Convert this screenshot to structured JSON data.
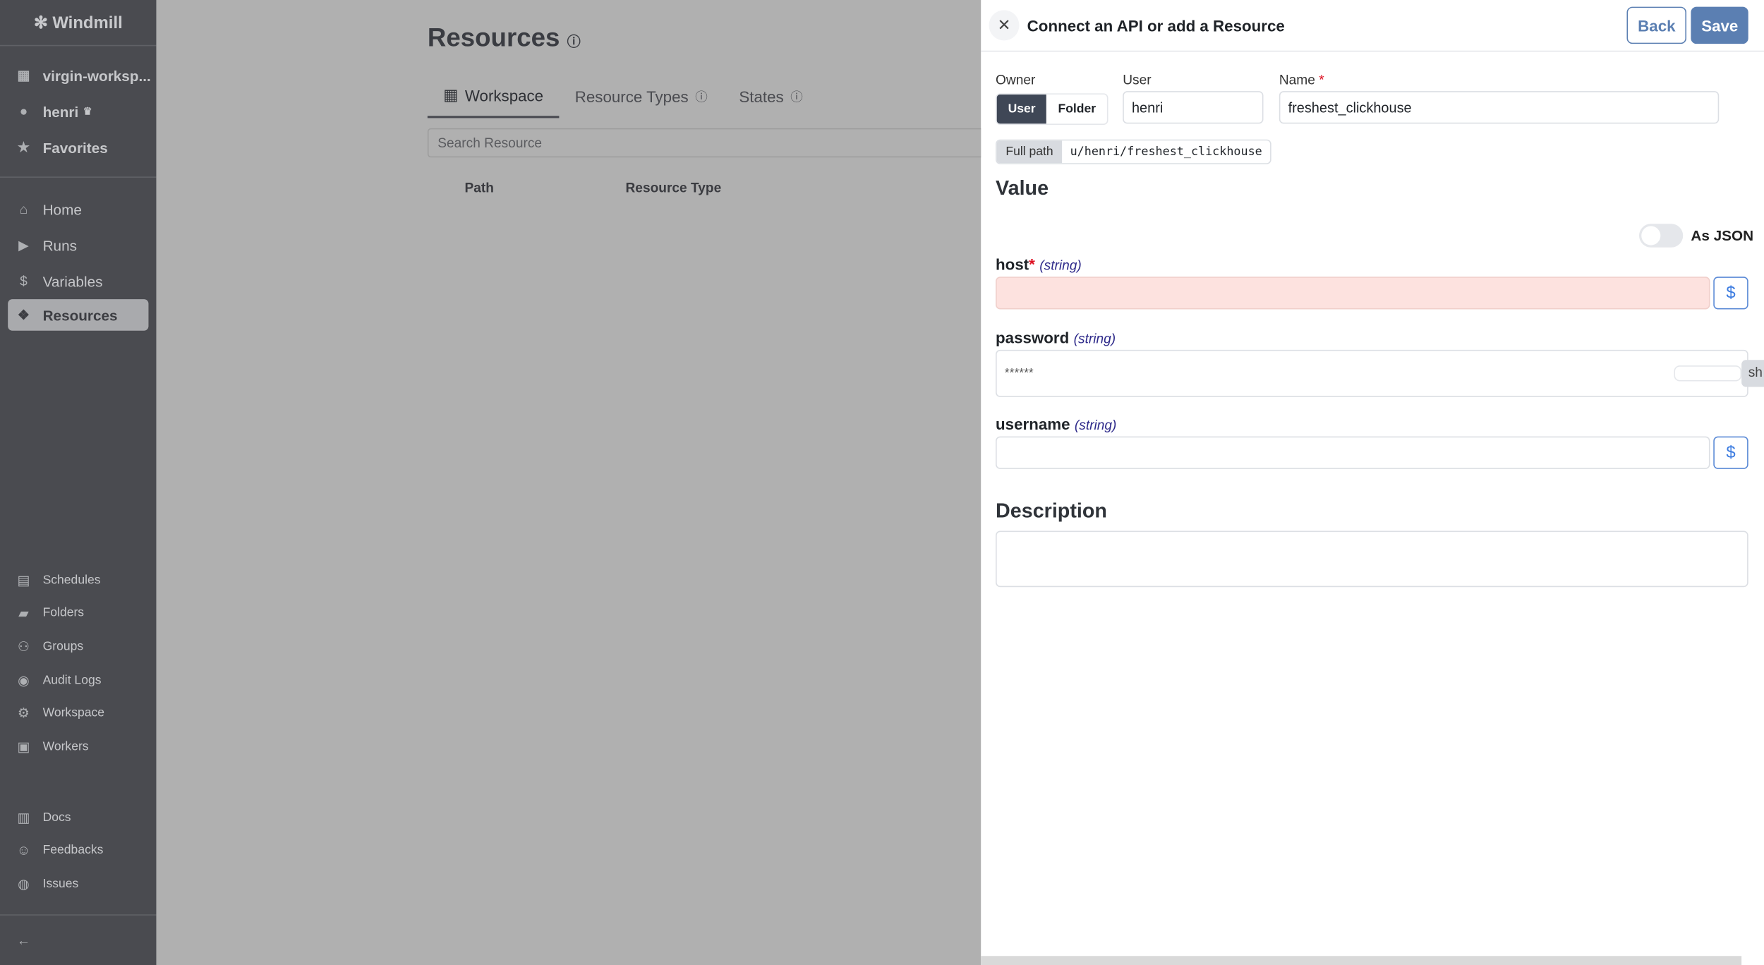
{
  "sidebar": {
    "brand": "Windmill",
    "workspace": "virgin-worksp...",
    "user": "henri",
    "favorites": "Favorites",
    "nav": [
      {
        "label": "Home",
        "icon": "home-icon"
      },
      {
        "label": "Runs",
        "icon": "play-icon"
      },
      {
        "label": "Variables",
        "icon": "dollar-icon"
      },
      {
        "label": "Resources",
        "icon": "cubes-icon",
        "active": true
      }
    ],
    "secondary": [
      {
        "label": "Schedules",
        "icon": "calendar-icon"
      },
      {
        "label": "Folders",
        "icon": "folder-icon"
      },
      {
        "label": "Groups",
        "icon": "users-icon"
      },
      {
        "label": "Audit Logs",
        "icon": "eye-icon"
      },
      {
        "label": "Workspace",
        "icon": "gear-icon"
      },
      {
        "label": "Workers",
        "icon": "robot-icon"
      }
    ],
    "links": [
      {
        "label": "Docs",
        "icon": "book-icon"
      },
      {
        "label": "Feedbacks",
        "icon": "discord-icon"
      },
      {
        "label": "Issues",
        "icon": "github-icon"
      }
    ]
  },
  "main": {
    "title": "Resources",
    "tabs": [
      "Workspace",
      "Resource Types",
      "States"
    ],
    "search_placeholder": "Search Resource",
    "columns": [
      "Path",
      "Resource Type"
    ]
  },
  "drawer": {
    "title": "Connect an API or add a Resource",
    "back": "Back",
    "save": "Save",
    "owner_label": "Owner",
    "owner_options": [
      "User",
      "Folder"
    ],
    "owner_selected": "User",
    "user_label": "User",
    "user_value": "henri",
    "name_label": "Name",
    "name_value": "freshest_clickhouse",
    "full_path_label": "Full path",
    "full_path": "u/henri/freshest_clickhouse",
    "value_heading": "Value",
    "as_json": "As JSON",
    "as_json_on": false,
    "fields": [
      {
        "name": "host",
        "type": "(string)",
        "required": true,
        "value": ""
      },
      {
        "name": "password",
        "type": "(string)",
        "value": "******",
        "show": "sh"
      },
      {
        "name": "username",
        "type": "(string)",
        "value": ""
      }
    ],
    "description_heading": "Description",
    "description": ""
  },
  "colors": {
    "accent": "#5b7fb2",
    "error_bg": "#fde2df",
    "type_hint": "#2e2a8a"
  }
}
